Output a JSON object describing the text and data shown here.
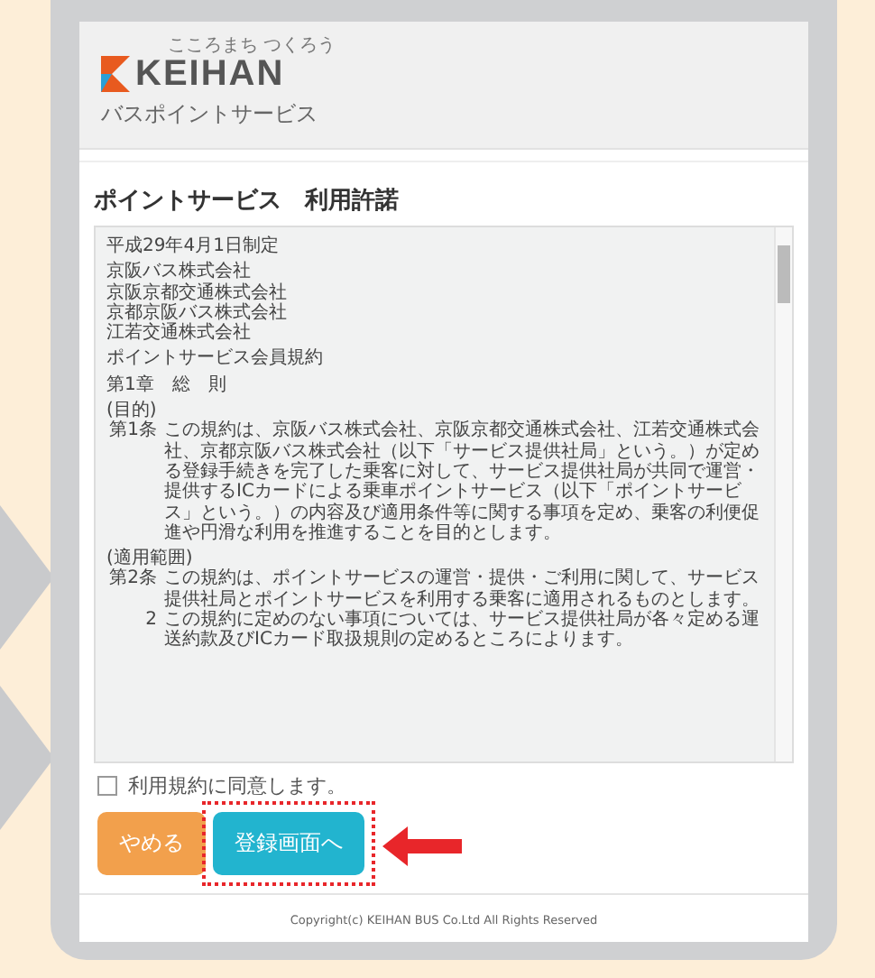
{
  "header": {
    "tagline": "こころまち つくろう",
    "logo": "KEIHAN",
    "service_name": "バスポイントサービス"
  },
  "title": "ポイントサービス　利用許諾",
  "terms": [
    {
      "kind": "line",
      "text": "平成29年4月1日制定"
    },
    {
      "kind": "gap"
    },
    {
      "kind": "line",
      "text": "京阪バス株式会社"
    },
    {
      "kind": "line",
      "text": "京阪京都交通株式会社"
    },
    {
      "kind": "line",
      "text": "京都京阪バス株式会社"
    },
    {
      "kind": "line",
      "text": "江若交通株式会社"
    },
    {
      "kind": "gap"
    },
    {
      "kind": "line",
      "text": "ポイントサービス会員規約"
    },
    {
      "kind": "gap"
    },
    {
      "kind": "line",
      "text": "第1章　総　則"
    },
    {
      "kind": "gap"
    },
    {
      "kind": "line",
      "text": "(目的)"
    },
    {
      "kind": "article",
      "label": "第1条",
      "text": "この規約は、京阪バス株式会社、京阪京都交通株式会社、江若交通株式会社、京都京阪バス株式会社（以下「サービス提供社局」という。）が定める登録手続きを完了した乗客に対して、サービス提供社局が共同で運営・提供するICカードによる乗車ポイントサービス（以下「ポイントサービス」という。）の内容及び適用条件等に関する事項を定め、乗客の利便促進や円滑な利用を推進することを目的とします。"
    },
    {
      "kind": "gap"
    },
    {
      "kind": "line",
      "text": "(適用範囲)"
    },
    {
      "kind": "article",
      "label": "第2条",
      "text": "この規約は、ポイントサービスの運営・提供・ご利用に関して、サービス提供社局とポイントサービスを利用する乗客に適用されるものとします。"
    },
    {
      "kind": "article",
      "label": "2",
      "text": "この規約に定めのない事項については、サービス提供社局が各々定める運送約款及びICカード取扱規則の定めるところによります。"
    }
  ],
  "agree": {
    "label": "利用規約に同意します。",
    "checked": false
  },
  "buttons": [
    {
      "label": "やめる",
      "kind": "cancel",
      "highlighted": false
    },
    {
      "label": "登録画面へ",
      "kind": "primary",
      "highlighted": true
    }
  ],
  "footer": "Copyright(c) KEIHAN BUS Co.Ltd All Rights Reserved"
}
